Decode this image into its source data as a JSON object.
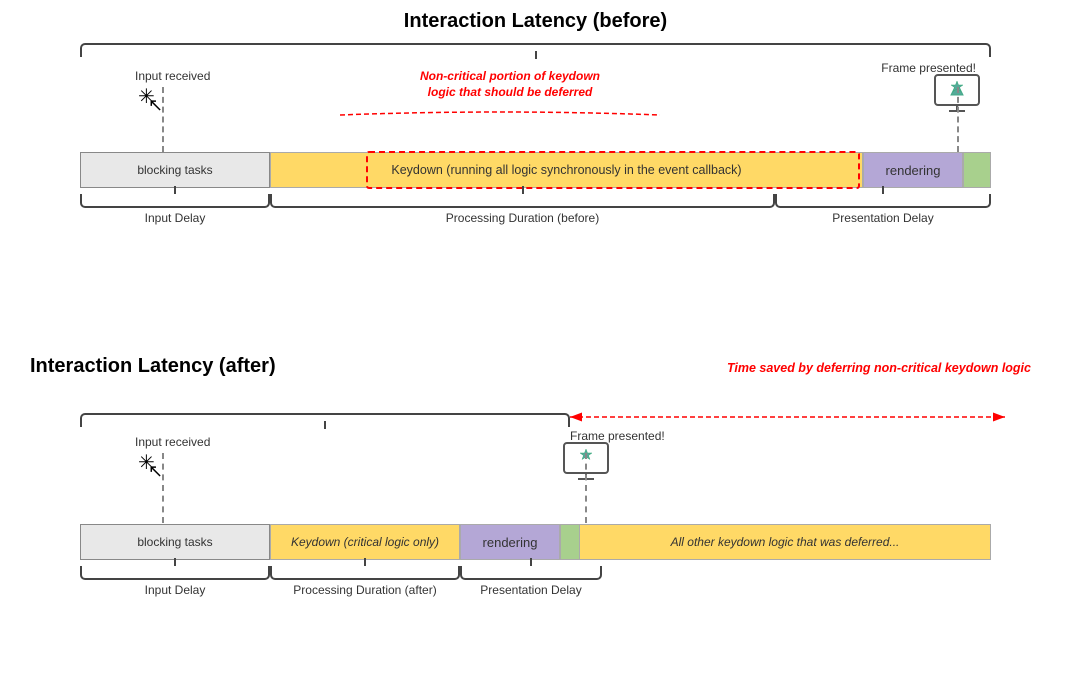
{
  "top": {
    "title": "Interaction Latency (before)",
    "input_received": "Input received",
    "frame_presented": "Frame presented!",
    "blocking_label": "blocking tasks",
    "keydown_label": "Keydown (running all logic synchronously in the event callback)",
    "rendering_label": "rendering",
    "input_delay_label": "Input Delay",
    "processing_duration_label": "Processing Duration (before)",
    "presentation_delay_label": "Presentation Delay",
    "noncritical_label": "Non-critical portion of keydown\nlogic that should be deferred"
  },
  "bottom": {
    "title": "Interaction Latency (after)",
    "input_received": "Input received",
    "frame_presented": "Frame presented!",
    "blocking_label": "blocking tasks",
    "keydown_label": "Keydown (critical logic only)",
    "rendering_label": "rendering",
    "deferred_label": "All other keydown logic that was deferred...",
    "input_delay_label": "Input Delay",
    "processing_duration_label": "Processing Duration (after)",
    "presentation_delay_label": "Presentation Delay",
    "time_saved_label": "Time saved by deferring\nnon-critical keydown logic"
  }
}
